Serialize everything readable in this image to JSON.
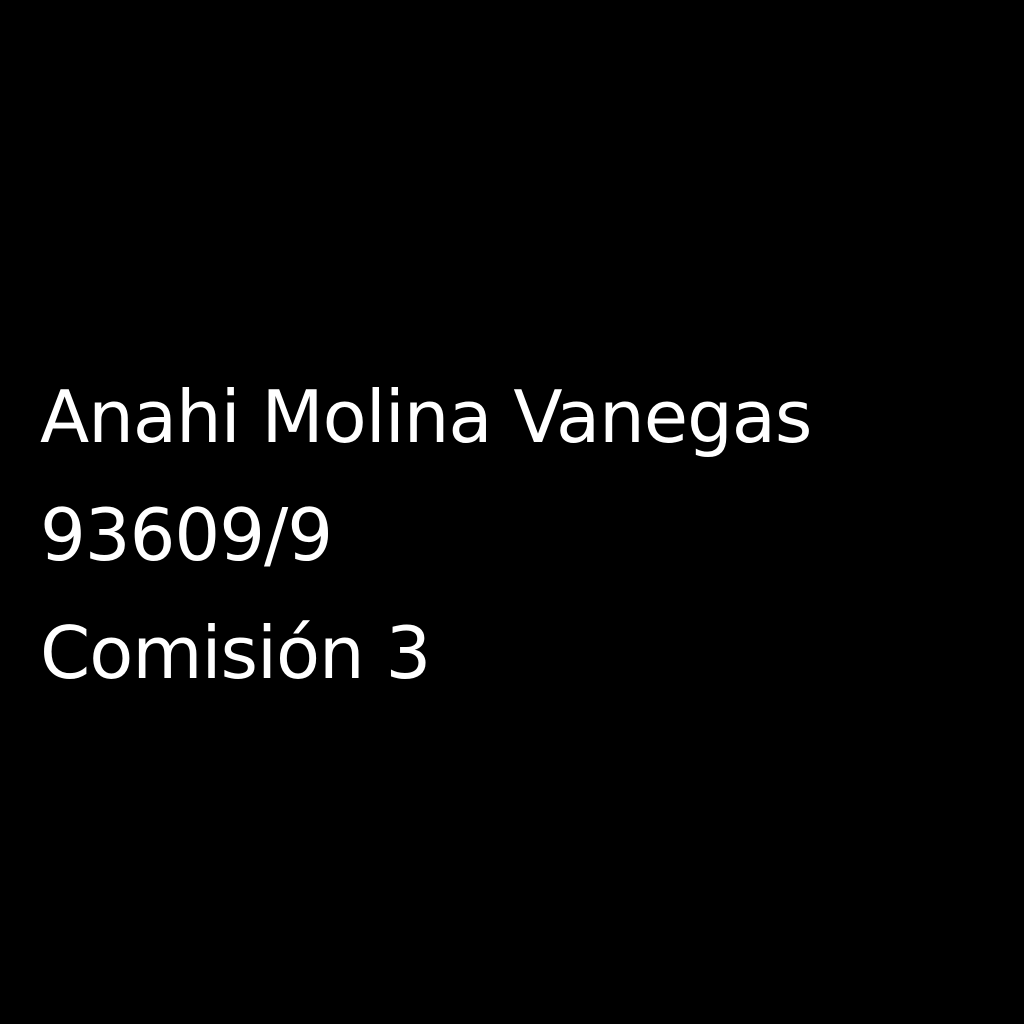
{
  "lines": {
    "name": "Anahi Molina Vanegas",
    "id_number": "93609/9",
    "commission": "Comisión 3"
  },
  "colors": {
    "background": "#000000",
    "text": "#ffffff"
  }
}
